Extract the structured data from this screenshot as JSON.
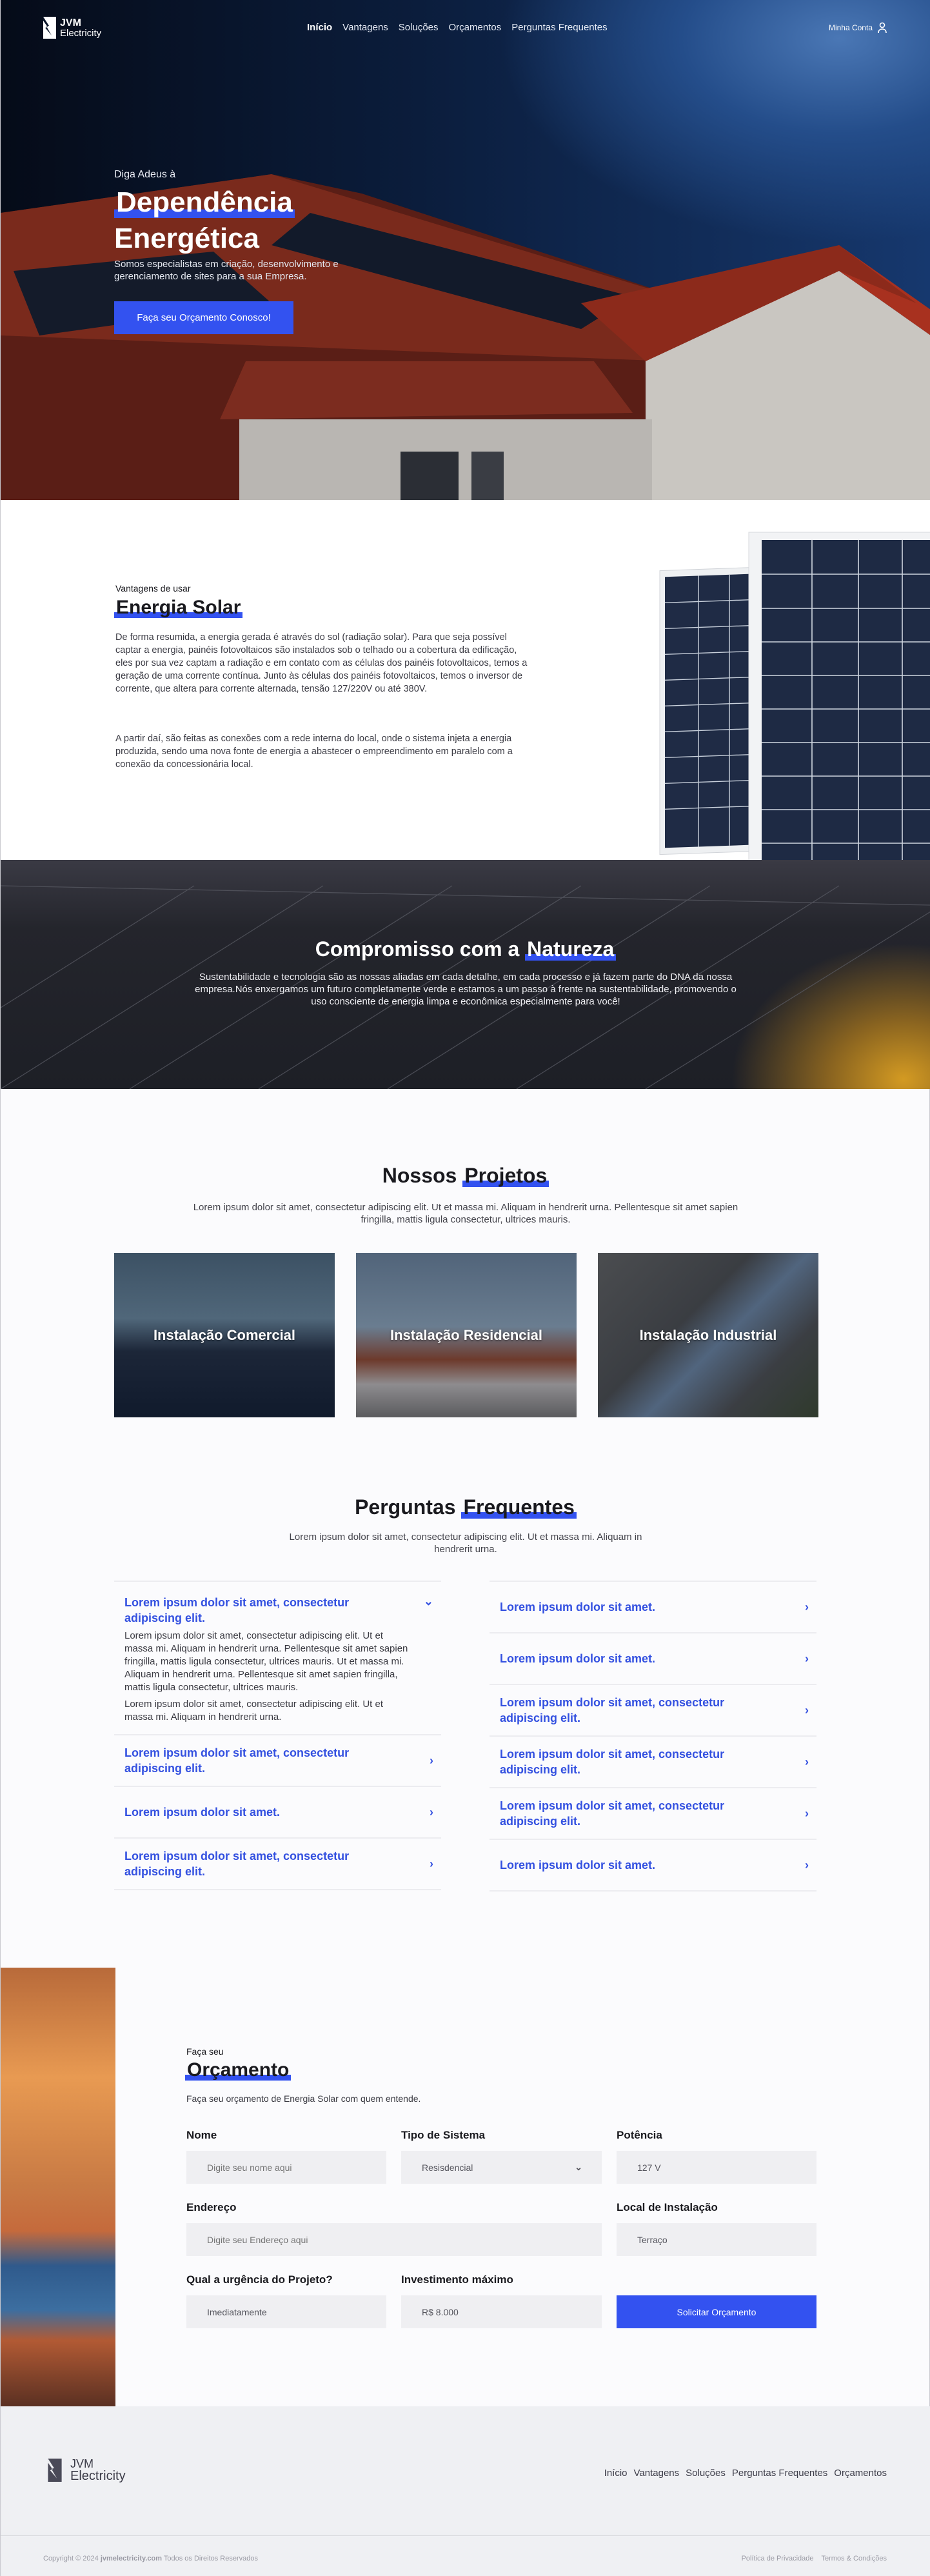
{
  "brand": {
    "name_line1": "JVM",
    "name_line2": "Electricity"
  },
  "nav": {
    "items": [
      "Início",
      "Vantagens",
      "Soluções",
      "Orçamentos",
      "Perguntas Frequentes"
    ],
    "active": 0,
    "account": "Minha Conta"
  },
  "hero": {
    "pre": "Diga Adeus à",
    "title_line1": "Dependência",
    "title_line2": "Energética",
    "text": "Somos especialistas em criação, desenvolvimento e gerenciamento de sites para a sua Empresa.",
    "cta": "Faça seu Orçamento Conosco!"
  },
  "advantages": {
    "pre": "Vantagens de usar",
    "title": "Energia Solar",
    "p1": "De forma resumida, a energia gerada é através do sol (radiação solar). Para que seja possível captar a energia, painéis fotovoltaicos são instalados sob o telhado ou a cobertura da edificação, eles por sua vez captam a radiação e em contato com as células dos painéis fotovoltaicos, temos a geração de uma corrente contínua. Junto às células dos painéis fotovoltaicos, temos o inversor de corrente, que altera para corrente alternada, tensão 127/220V ou até 380V.",
    "p2": "A partir daí, são feitas as conexões com a rede interna do local, onde o sistema injeta a energia produzida, sendo uma nova fonte de energia a abastecer o empreendimento em paralelo com a conexão da concessionária local."
  },
  "nature": {
    "title_a": "Compromisso com a",
    "title_b": "Natureza",
    "text": "Sustentabilidade e tecnologia são as nossas aliadas em cada detalhe, em cada processo e já fazem parte do DNA da nossa empresa.Nós enxergamos um futuro completamente verde e estamos a um passo à frente na sustentabilidade, promovendo o uso consciente de energia limpa e econômica especialmente para você!"
  },
  "projects": {
    "title_a": "Nossos",
    "title_b": "Projetos",
    "text": "Lorem ipsum dolor sit amet, consectetur adipiscing elit. Ut et massa mi. Aliquam in hendrerit urna. Pellentesque sit amet sapien fringilla, mattis ligula consectetur, ultrices mauris.",
    "cards": [
      "Instalação Comercial",
      "Instalação Residencial",
      "Instalação Industrial"
    ]
  },
  "faq": {
    "title_a": "Perguntas",
    "title_b": "Frequentes",
    "text": "Lorem ipsum dolor sit amet, consectetur adipiscing elit. Ut et massa mi. Aliquam in hendrerit urna.",
    "left": [
      {
        "q": "Lorem ipsum dolor sit amet, consectetur adipiscing elit.",
        "a1": "Lorem ipsum dolor sit amet, consectetur adipiscing elit. Ut et massa mi. Aliquam in hendrerit urna. Pellentesque sit amet sapien fringilla, mattis ligula consectetur, ultrices mauris. Ut et massa mi. Aliquam in hendrerit urna. Pellentesque sit amet sapien fringilla, mattis ligula consectetur, ultrices mauris.",
        "a2": "Lorem ipsum dolor sit amet, consectetur adipiscing elit. Ut et massa mi. Aliquam in hendrerit urna."
      },
      {
        "q": "Lorem ipsum dolor sit amet, consectetur adipiscing elit."
      },
      {
        "q": "Lorem ipsum dolor sit amet."
      },
      {
        "q": "Lorem ipsum dolor sit amet, consectetur adipiscing elit."
      }
    ],
    "right": [
      {
        "q": "Lorem ipsum dolor sit amet."
      },
      {
        "q": "Lorem ipsum dolor sit amet."
      },
      {
        "q": "Lorem ipsum dolor sit amet, consectetur adipiscing elit."
      },
      {
        "q": "Lorem ipsum dolor sit amet, consectetur adipiscing elit."
      },
      {
        "q": "Lorem ipsum dolor sit amet, consectetur adipiscing elit."
      },
      {
        "q": "Lorem ipsum dolor sit amet."
      }
    ]
  },
  "quote": {
    "pre": "Faça seu",
    "title": "Orçamento",
    "subtitle": "Faça seu orçamento de Energia Solar com quem entende.",
    "fields": {
      "name": {
        "label": "Nome",
        "placeholder": "Digite seu nome aqui"
      },
      "system": {
        "label": "Tipo de Sistema",
        "value": "Resisdencial"
      },
      "power": {
        "label": "Potência",
        "value": "127 V"
      },
      "address": {
        "label": "Endereço",
        "placeholder": "Digite seu Endereço aqui"
      },
      "location": {
        "label": "Local de Instalação",
        "value": "Terraço"
      },
      "urgency": {
        "label": "Qual a urgência do Projeto?",
        "value": "Imediatamente"
      },
      "budget": {
        "label": "Investimento máximo",
        "value": "R$ 8.000"
      }
    },
    "submit": "Solicitar Orçamento"
  },
  "footer": {
    "menu": [
      "Início",
      "Vantagens",
      "Soluções",
      "Perguntas Frequentes",
      "Orçamentos"
    ],
    "copyright_a": "Copyright © 2024",
    "copyright_site": "jvmelectricity.com",
    "copyright_b": "Todos os Direitos Reservados",
    "links": [
      "Política de Privacidade",
      "Termos & Condições"
    ]
  },
  "colors": {
    "accent": "#3352f0",
    "faq_blue": "#3350e0",
    "input_bg": "#efeff2",
    "footer_bg": "#eff0f3"
  }
}
